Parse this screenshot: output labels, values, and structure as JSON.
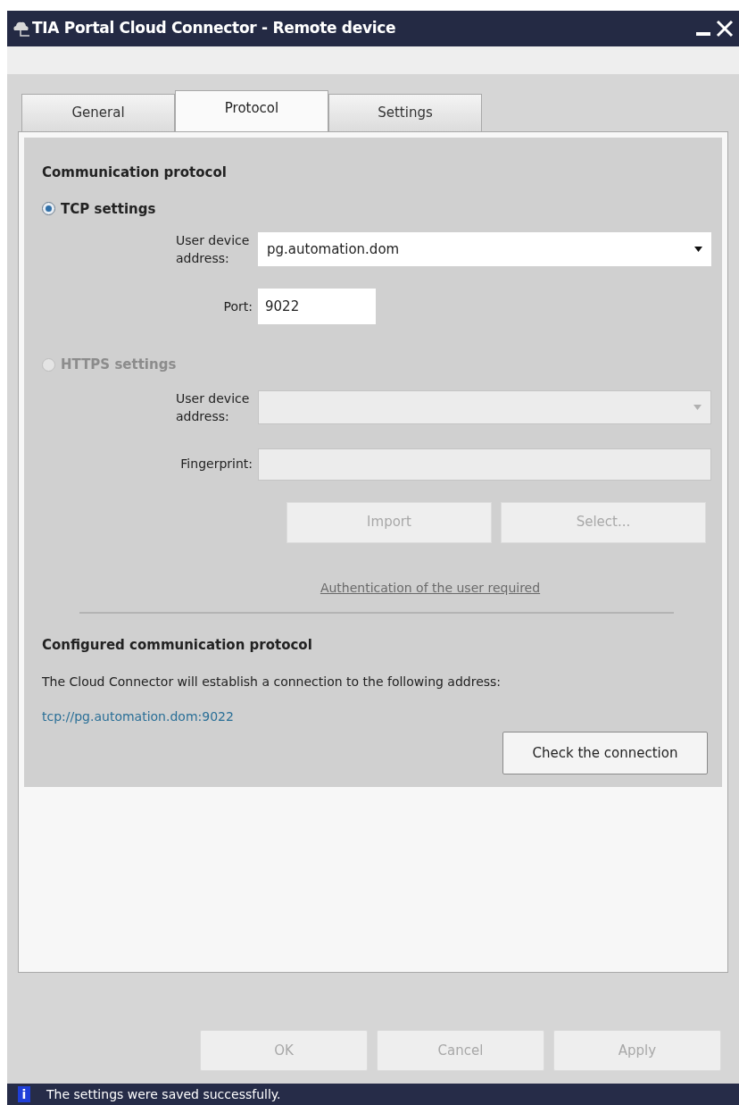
{
  "window": {
    "title": "TIA Portal Cloud Connector - Remote device"
  },
  "tabs": [
    {
      "label": "General",
      "selected": false
    },
    {
      "label": "Protocol",
      "selected": true
    },
    {
      "label": "Settings",
      "selected": false
    }
  ],
  "protocol": {
    "heading": "Communication protocol",
    "tcp": {
      "label": "TCP settings",
      "selected": true,
      "address_label": "User device address:",
      "address": "pg.automation.dom",
      "port_label": "Port:",
      "port": "9022"
    },
    "https": {
      "label": "HTTPS settings",
      "selected": false,
      "disabled": true,
      "address_label": "User device address:",
      "fingerprint_label": "Fingerprint:",
      "buttons": [
        {
          "label": "Import",
          "disabled": true
        },
        {
          "label": "Select...",
          "disabled": true
        }
      ]
    },
    "auth_link": "Authentication of the user required"
  },
  "configured": {
    "heading": "Configured communication protocol",
    "description": "The Cloud Connector will establish a connection to the following address:",
    "address": "tcp://pg.automation.dom:9022",
    "check_button": "Check the connection"
  },
  "buttons": [
    {
      "label": "OK",
      "disabled": true
    },
    {
      "label": "Cancel",
      "disabled": true
    },
    {
      "label": "Apply",
      "disabled": true
    }
  ],
  "status_bar": {
    "message": "The settings were saved successfully.",
    "icon_text": "i"
  }
}
